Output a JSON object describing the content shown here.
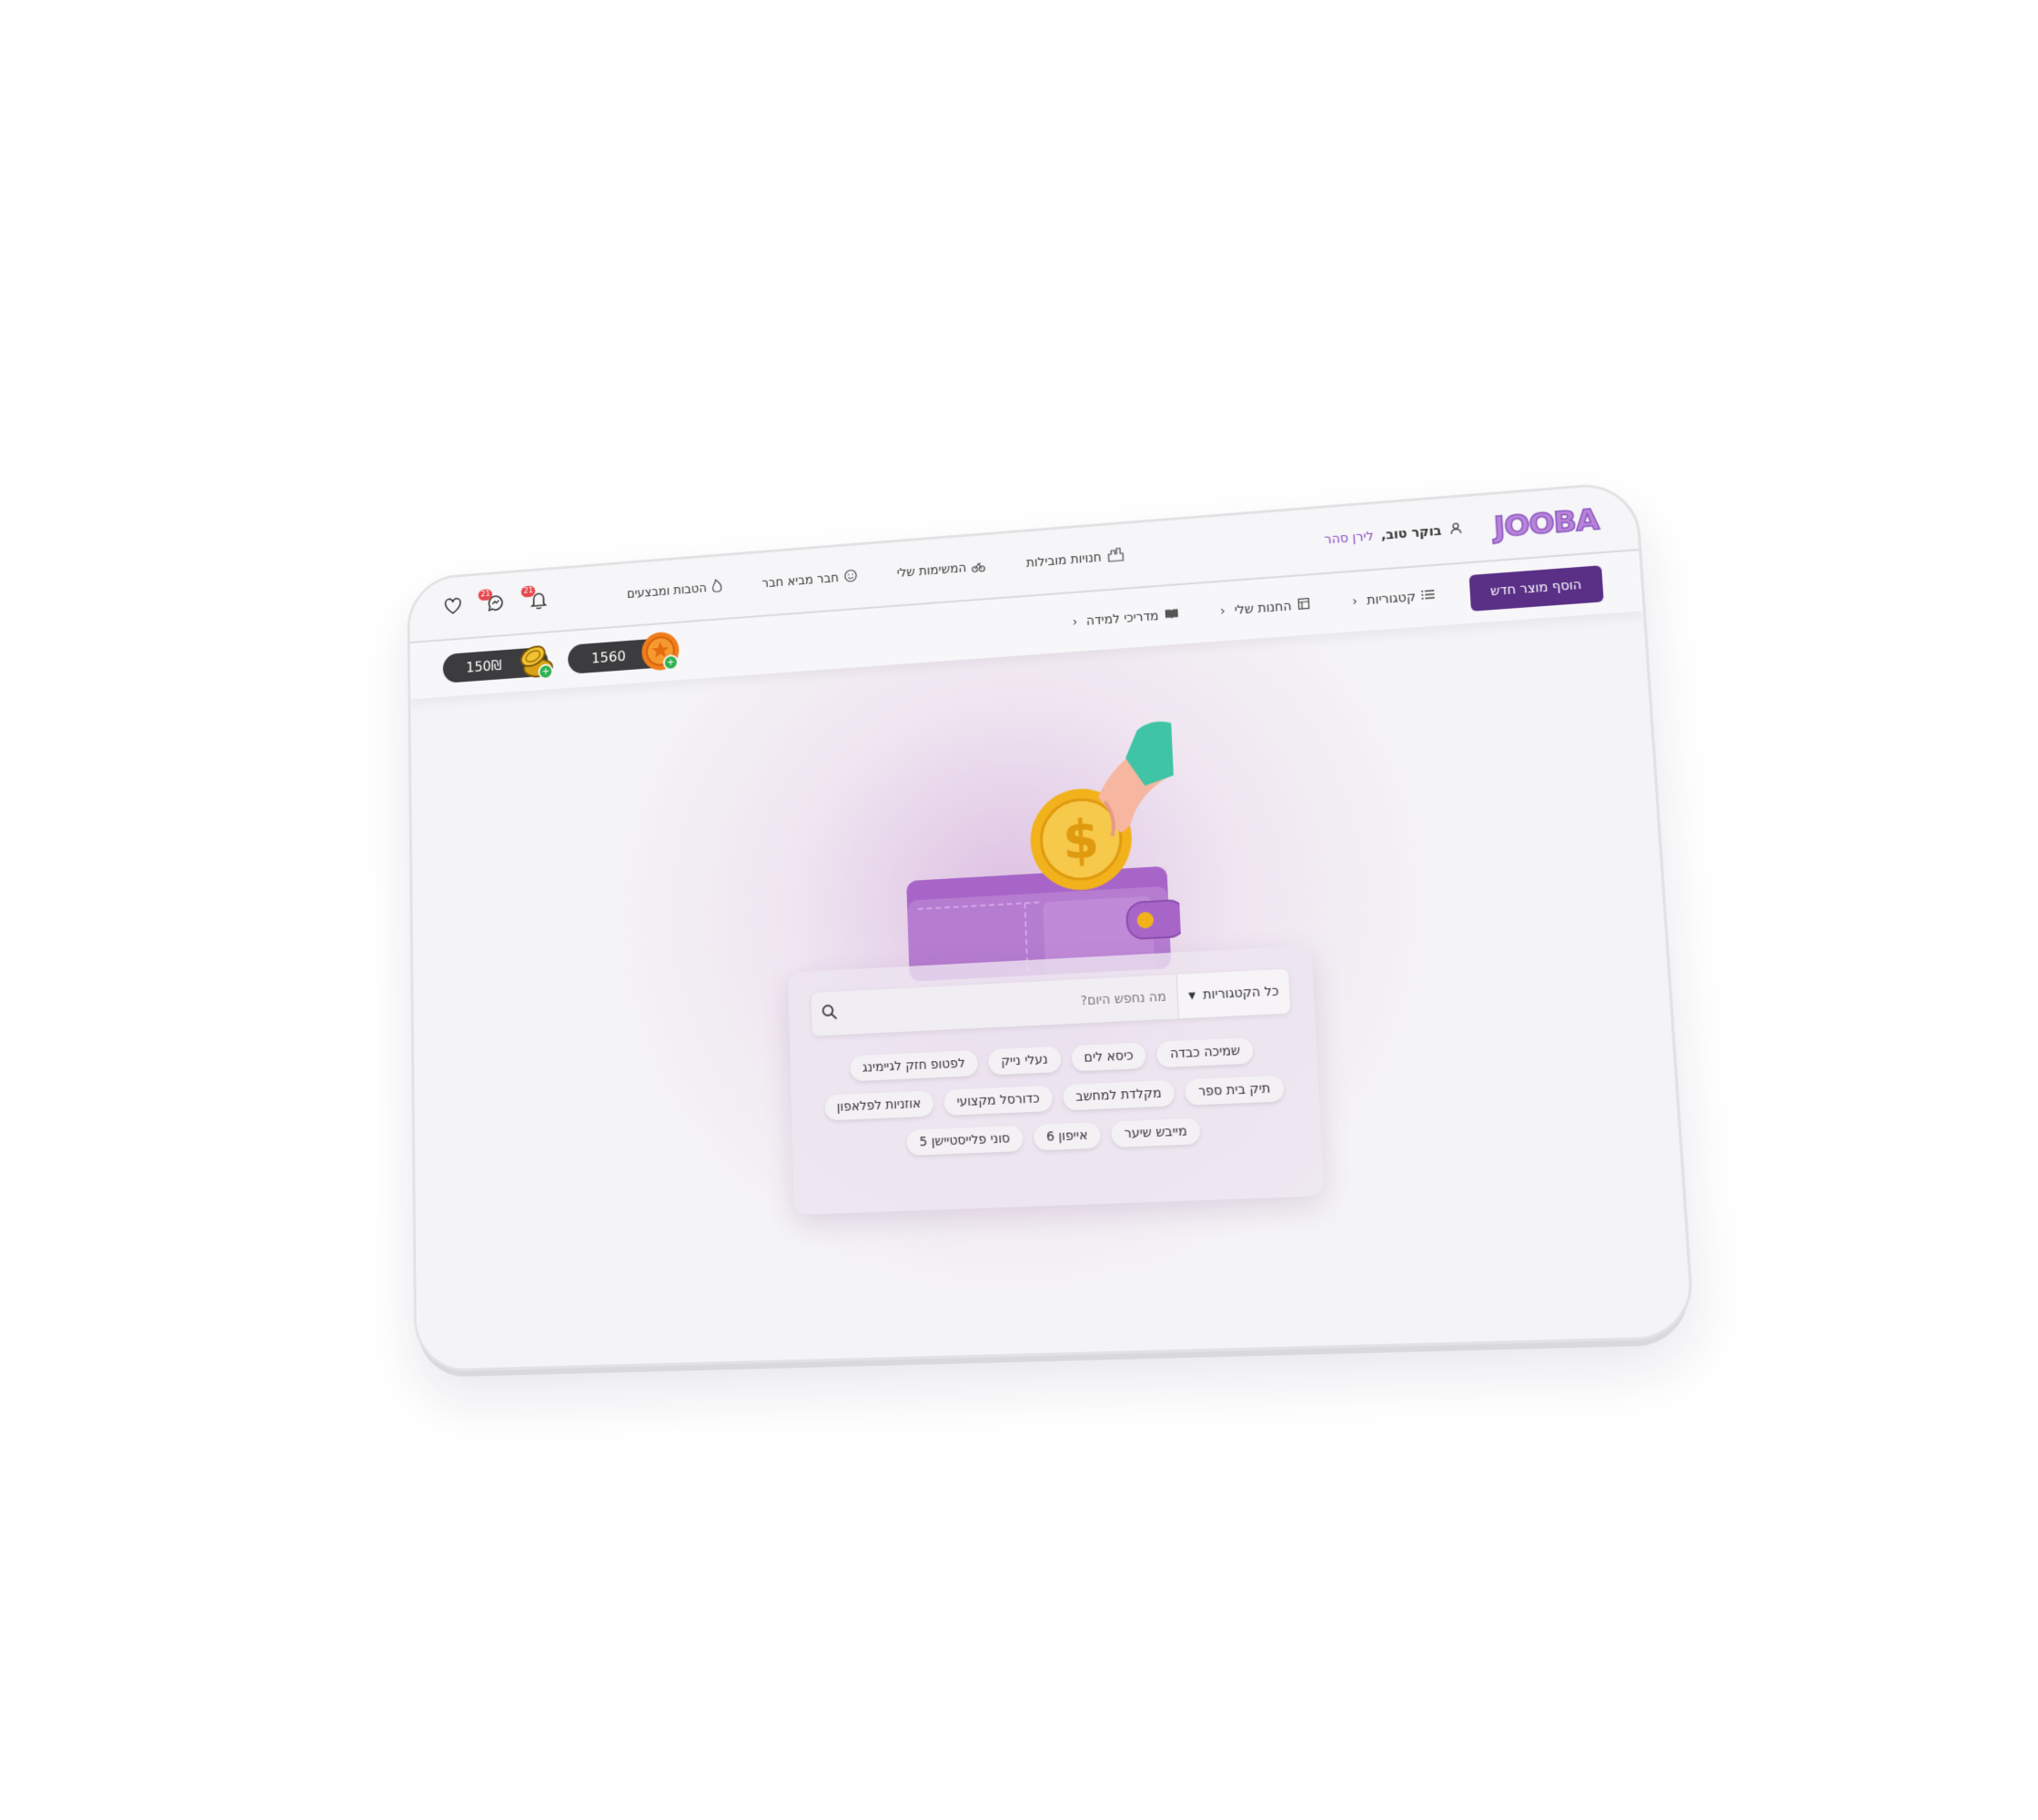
{
  "brand": {
    "logo_text": "JOOBA"
  },
  "header": {
    "greeting": "בוקר טוב,",
    "user_name": "לירן סהר",
    "nav": [
      {
        "label": "חנויות מובילות",
        "icon": "store-icon"
      },
      {
        "label": "המשימות שלי",
        "icon": "tasks-icon"
      },
      {
        "label": "חבר מביא חבר",
        "icon": "smiley-icon"
      },
      {
        "label": "הטבות ומבצעים",
        "icon": "fire-icon"
      }
    ],
    "notifications": {
      "bell_count": "21",
      "messages_count": "21"
    }
  },
  "subbar": {
    "add_product": "הוסף מוצר חדש",
    "nav": [
      {
        "label": "קטגוריות",
        "icon": "list-icon"
      },
      {
        "label": "החנות שלי",
        "icon": "shop-icon"
      },
      {
        "label": "מדריכי למידה",
        "icon": "book-icon"
      }
    ],
    "points_balance": "1560",
    "cash_balance": "150₪"
  },
  "search": {
    "category_selected": "כל הקטגוריות",
    "placeholder": "מה נחפש היום?",
    "chips": [
      [
        "שמיכה כבדה",
        "כיסא לים",
        "נעלי נייק",
        "לפטופ חזק לגיימינג"
      ],
      [
        "תיק בית ספר",
        "מקלדת למחשב",
        "כדורסל מקצועי",
        "אוזניות לפלאפון"
      ],
      [
        "מייבש שיער",
        "אייפון 6",
        "סוני פלייסטיישן 5"
      ]
    ]
  },
  "colors": {
    "brand_purple": "#5a2f86",
    "logo_purple": "#b684d8",
    "badge_red": "#e5484d",
    "wallet_purple": "#b57cd0",
    "coin_gold": "#f2b21b",
    "sleeve_teal": "#3fc4a6"
  }
}
